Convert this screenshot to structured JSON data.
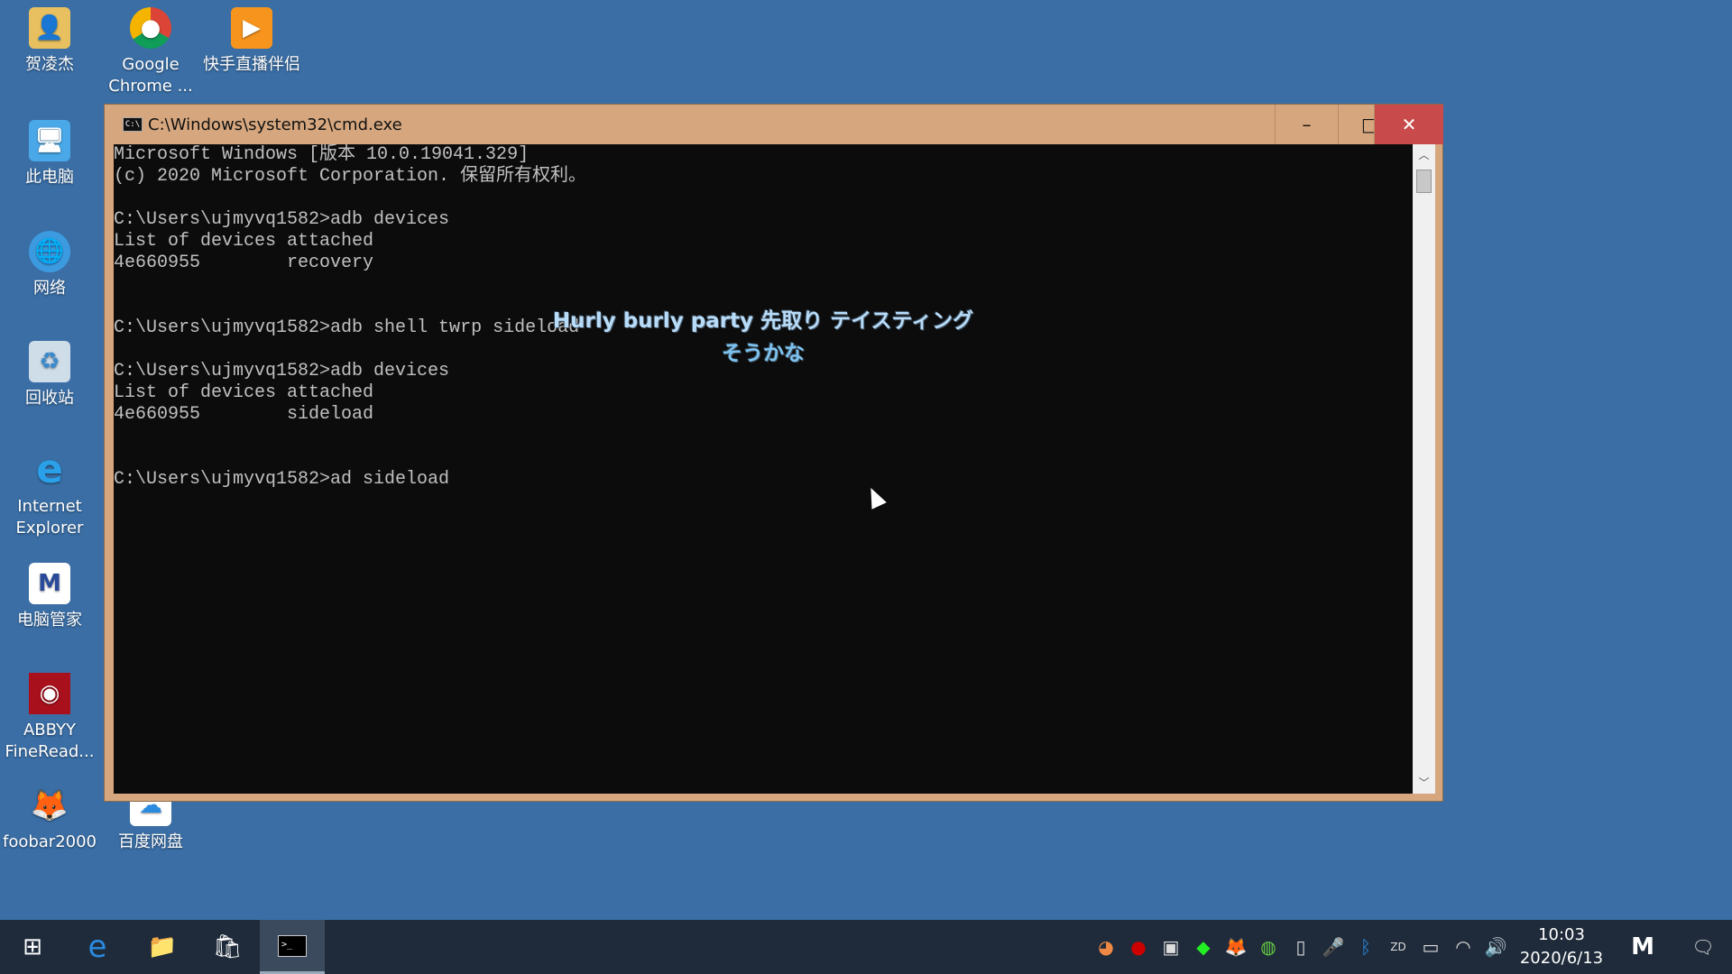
{
  "desktop": {
    "icons": [
      {
        "label": "贺凌杰",
        "icon": "user-folder-icon"
      },
      {
        "label": "Google Chrome ...",
        "icon": "chrome-dev-icon"
      },
      {
        "label": "快手直播伴侣",
        "icon": "kuaishou-icon"
      },
      {
        "label": "此电脑",
        "icon": "computer-icon"
      },
      {
        "label": "网络",
        "icon": "network-icon"
      },
      {
        "label": "回收站",
        "icon": "recycle-bin-icon"
      },
      {
        "label": "Internet Explorer",
        "icon": "ie-icon"
      },
      {
        "label": "电脑管家",
        "icon": "pc-manager-icon"
      },
      {
        "label": "ABBYY FineRead...",
        "icon": "abbyy-icon"
      },
      {
        "label": "foobar2000",
        "icon": "foobar-icon"
      },
      {
        "label": "百度网盘",
        "icon": "baidu-netdisk-icon"
      }
    ]
  },
  "window": {
    "title": "C:\\Windows\\system32\\cmd.exe",
    "minimize": "–",
    "maximize": "□",
    "close": "✕",
    "lines": [
      "Microsoft Windows [版本 10.0.19041.329]",
      "(c) 2020 Microsoft Corporation. 保留所有权利。",
      "",
      "C:\\Users\\ujmyvq1582>adb devices",
      "List of devices attached",
      "4e660955        recovery",
      "",
      "",
      "C:\\Users\\ujmyvq1582>adb shell twrp sideload",
      "",
      "C:\\Users\\ujmyvq1582>adb devices",
      "List of devices attached",
      "4e660955        sideload",
      "",
      "",
      "C:\\Users\\ujmyvq1582>ad sideload"
    ],
    "subtitle_line1": "Hurly burly party 先取り テイスティング",
    "subtitle_line2": "そうかな"
  },
  "taskbar": {
    "time": "10:03",
    "date": "2020/6/13"
  },
  "colors": {
    "desktop": "#3a6ea5",
    "titlebar": "#d6a77e",
    "close": "#c84a4a",
    "taskbar": "#1f2b3a"
  }
}
